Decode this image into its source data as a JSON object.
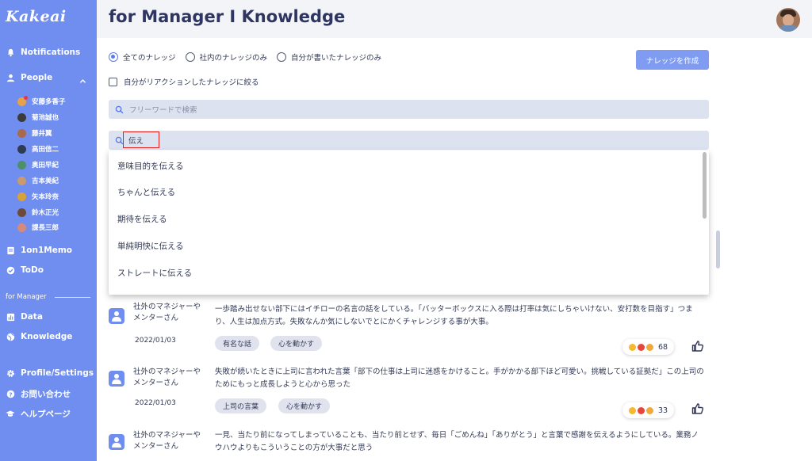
{
  "app": {
    "logo": "Kakeai"
  },
  "sidebar": {
    "notifications": "Notifications",
    "people": "People",
    "people_list": [
      {
        "name": "安藤多香子",
        "color": "#e6a24a",
        "badge": true
      },
      {
        "name": "菊池誠也",
        "color": "#3b3b3b",
        "badge": false
      },
      {
        "name": "藤井翼",
        "color": "#a86a4a",
        "badge": false
      },
      {
        "name": "高田信二",
        "color": "#2f3a55",
        "badge": false
      },
      {
        "name": "奥田早紀",
        "color": "#4d8f6a",
        "badge": false
      },
      {
        "name": "吉本美紀",
        "color": "#c99a6e",
        "badge": false
      },
      {
        "name": "矢本玲奈",
        "color": "#d9a13a",
        "badge": false
      },
      {
        "name": "鈴木正光",
        "color": "#6b4a3a",
        "badge": false
      },
      {
        "name": "課長三郎",
        "color": "#d88a7a",
        "badge": false
      }
    ],
    "memo": "1on1Memo",
    "todo": "ToDo",
    "section_label": "for Manager",
    "data": "Data",
    "knowledge": "Knowledge",
    "profile": "Profile/Settings",
    "contact": "お問い合わせ",
    "help": "ヘルプページ"
  },
  "header": {
    "title": "for Manager I Knowledge"
  },
  "filters": {
    "radios": [
      {
        "label": "全てのナレッジ",
        "selected": true
      },
      {
        "label": "社内のナレッジのみ",
        "selected": false
      },
      {
        "label": "自分が書いたナレッジのみ",
        "selected": false
      }
    ],
    "checkbox": "自分がリアクションしたナレッジに絞る",
    "create_button": "ナレッジを作成"
  },
  "search": {
    "keyword_placeholder": "フリーワードで検索",
    "tag_value": "伝え"
  },
  "suggestions": [
    "意味目的を伝える",
    "ちゃんと伝える",
    "期待を伝える",
    "単純明快に伝える",
    "ストレートに伝える"
  ],
  "knowledge_items": [
    {
      "author": "社外のマネジャーやメンターさん",
      "date": "2022/01/03",
      "text": "一歩踏み出せない部下にはイチローの名言の話をしている。「バッターボックスに入る際は打率は気にしちゃいけない、安打数を目指す」つまり、人生は加点方式。失敗なんか気にしないでとにかくチャレンジする事が大事。",
      "tags": [
        "有名な話",
        "心を動かす"
      ],
      "reactions": "68"
    },
    {
      "author": "社外のマネジャーやメンターさん",
      "date": "2022/01/03",
      "text": "失敗が続いたときに上司に言われた言葉「部下の仕事は上司に迷惑をかけること。手がかかる部下ほど可愛い。挑戦している証拠だ」この上司のためにもっと成長しようと心から思った",
      "tags": [
        "上司の言葉",
        "心を動かす"
      ],
      "reactions": "33"
    },
    {
      "author": "社外のマネジャーやメンターさん",
      "text": "一見、当たり前になってしまっていることも、当たり前とせず、毎日「ごめんね」「ありがとう」と言葉で感謝を伝えるようにしている。業務ノウハウよりもこういうことの方が大事だと思う"
    }
  ],
  "colors": {
    "sidebar": "#6f8ef0",
    "accent": "#5b7be6",
    "highlight_box": "#e0201e"
  }
}
